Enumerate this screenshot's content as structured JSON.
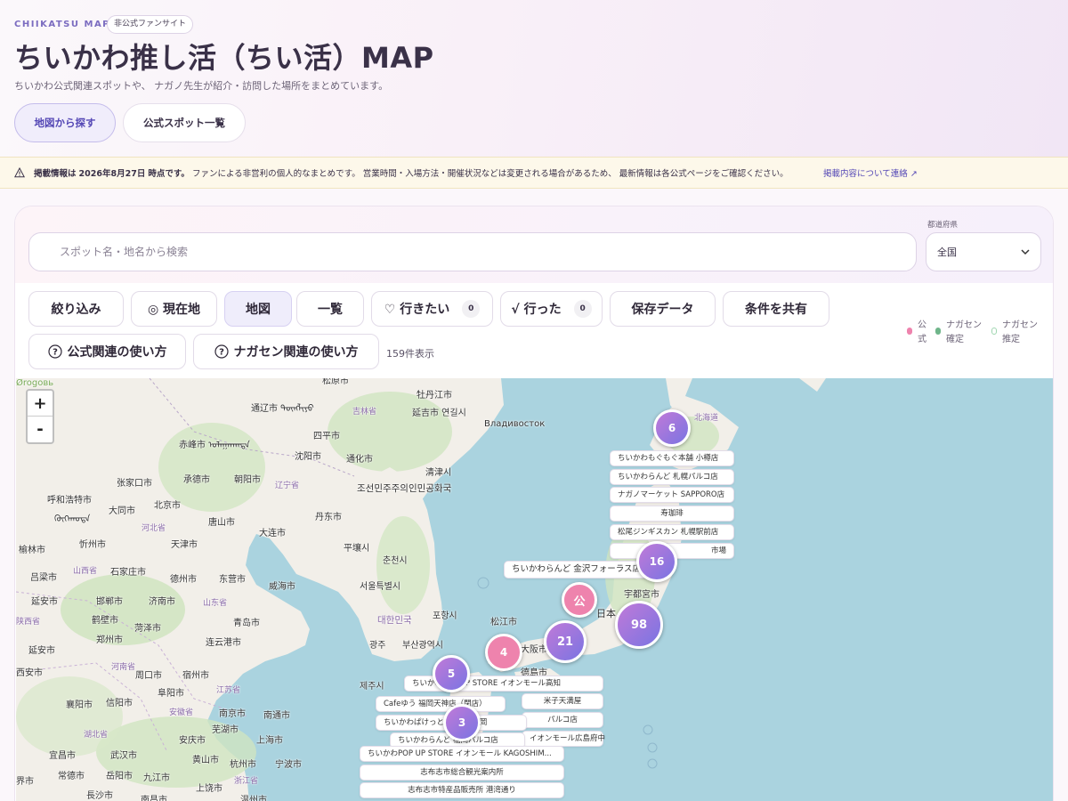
{
  "header": {
    "brand": "CHIIKATSU MAP",
    "badge": "非公式ファンサイト",
    "title": "ちいかわ推し活（ちい活）MAP",
    "subtitle": "ちいかわ公式関連スポットや、 ナガノ先生が紹介・訪問した場所をまとめています。",
    "nav": {
      "map_label": "地図から探す",
      "list_label": "公式スポット一覧"
    }
  },
  "notice": {
    "date_prefix": "掲載情報は",
    "date": "2026年8月27日",
    "date_suffix": "時点です。",
    "body": "ファンによる非営利の個人的なまとめです。 営業時間・入場方法・開催状況などは変更される場合があるため、 最新情報は各公式ページをご確認ください。",
    "link": "掲載内容について連絡 ↗"
  },
  "search": {
    "placeholder": "スポット名・地名から検索",
    "pref_label": "都道府県",
    "pref_value": "全国"
  },
  "toolbar": {
    "filter": "絞り込み",
    "current_location": "◎ 現在地",
    "map": "地図",
    "list": "一覧",
    "want": "♡ 行きたい",
    "want_count": "0",
    "went": "√ 行った",
    "went_count": "0",
    "saved": "保存データ",
    "share": "条件を共有",
    "official_help": "公式関連の使い方",
    "nagasen_help": "ナガセン関連の使い方",
    "count_text": "159件表示"
  },
  "legend": {
    "official": "公式",
    "official_color": "#ee83ad",
    "nagasen_confirmed": "ナガセン確定",
    "confirmed_color": "#6fb58a",
    "nagasen_estimated": "ナガセン推定",
    "estimated_color": "#9fd6b0"
  },
  "map": {
    "zoom_in": "+",
    "zoom_out": "-",
    "places": [
      "Ørogoвь",
      "松原市",
      "通辽市 ᠲᠦᠩᠯᠢᠶᠣ",
      "吉林省",
      "牡丹江市",
      "延吉市 연길시",
      "Владивосток",
      "赤峰市 ᠤᠯᠠᠭᠠᠨᠬᠠᠳᠠ",
      "四平市",
      "通化市",
      "沈阳市",
      "清津시",
      "张家口市",
      "承德市",
      "朝阳市",
      "辽宁省",
      "조선민주주의인민공화국",
      "呼和浩特市",
      "大同市",
      "北京市",
      "丹东市",
      "ᠬᠥᠬᠡᠬᠣᠲᠠ",
      "河北省",
      "唐山市",
      "大连市",
      "平壤시",
      "榆林市",
      "忻州市",
      "天津市",
      "춘천시",
      "吕梁市",
      "石家庄市",
      "山西省",
      "德州市",
      "东营市",
      "서울특별시",
      "威海市",
      "延安市",
      "邯郸市",
      "济南市",
      "山东省",
      "宇都宮市",
      "陕西省",
      "鹤壁市",
      "菏泽市",
      "青岛市",
      "대한민국",
      "포항시",
      "日本",
      "郑州市",
      "松江市",
      "延安市",
      "连云港市",
      "광주",
      "부산광역시",
      "大阪市",
      "河南省",
      "周口市",
      "宿州市",
      "德島市",
      "西安市",
      "제주시",
      "襄阳市",
      "信阳市",
      "阜阳市",
      "江苏省",
      "安徽省",
      "南京市",
      "南通市",
      "湖北省",
      "芜湖市",
      "宜昌市",
      "武汉市",
      "安庆市",
      "上海市",
      "黄山市",
      "杭州市",
      "宁波市",
      "常德市",
      "岳阳市",
      "九江市",
      "浙江省",
      "長沙市",
      "南昌市",
      "温州市",
      "上饶市",
      "界市",
      "北海道"
    ],
    "clusters": [
      {
        "label": "6"
      },
      {
        "label": "16"
      },
      {
        "label": "公"
      },
      {
        "label": "98"
      },
      {
        "label": "21"
      },
      {
        "label": "4"
      },
      {
        "label": "5"
      },
      {
        "label": "3"
      }
    ],
    "labels": [
      "ちいかわもぐもぐ本舗 小樽店",
      "ちいかわらんど 札幌パルコ店",
      "ナガノマーケット SAPPORO店",
      "寿珈琲",
      "松尾ジンギスカン 札幌駅前店",
      "市場",
      "ちいかわらんど 金沢フォーラス店",
      "ちいかわPOP UP STORE イオンモール高知",
      "米子天満屋",
      "Cafeゆう 福岡天神店（閉店）",
      "パルコ店",
      "ちいかわぱけっとSTORE 福岡",
      "イオンモール広島府中",
      "ちいかわらんど 福岡パルコ店",
      "ちいかわPOP UP STORE イオンモール KAGOSHIM...",
      "志布志市総合観光案内所",
      "志布志市特産品販売所 港湾通り"
    ]
  }
}
